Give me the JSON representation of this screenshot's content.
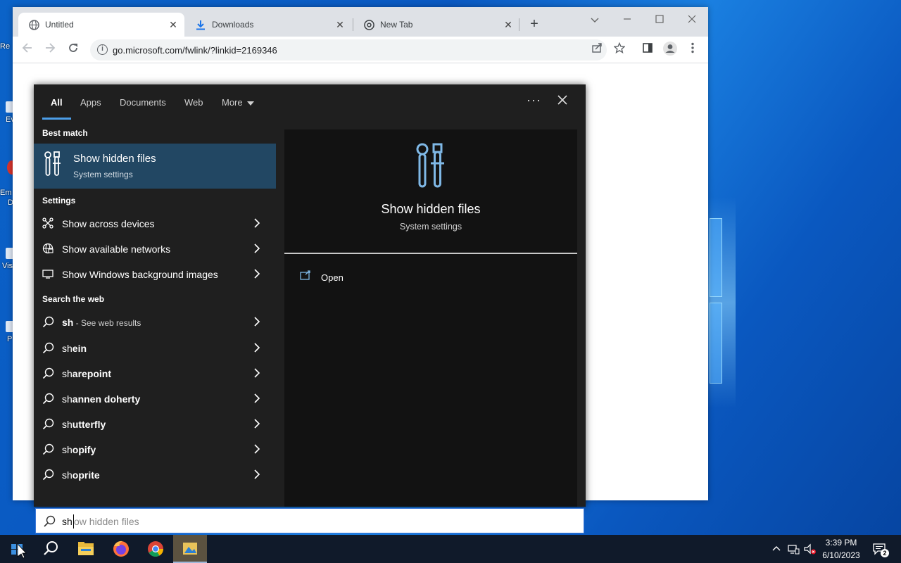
{
  "desktop": {
    "icon_labels": [
      "Re",
      "Ev",
      "Em",
      "D",
      "Vis",
      "P"
    ]
  },
  "browser": {
    "tabs": [
      {
        "title": "Untitled",
        "icon": "globe-icon",
        "active": true
      },
      {
        "title": "Downloads",
        "icon": "download-icon",
        "active": false
      },
      {
        "title": "New Tab",
        "icon": "chrome-icon",
        "active": false
      }
    ],
    "newtab_label": "+",
    "url": "go.microsoft.com/fwlink/?linkid=2169346"
  },
  "search": {
    "tabs": [
      {
        "label": "All",
        "active": true
      },
      {
        "label": "Apps"
      },
      {
        "label": "Documents"
      },
      {
        "label": "Web"
      },
      {
        "label": "More"
      }
    ],
    "dots_label": "···",
    "best_match_heading": "Best match",
    "best_match": {
      "title": "Show hidden files",
      "subtitle": "System settings"
    },
    "settings_heading": "Settings",
    "settings": [
      {
        "label": "Show across devices",
        "icon": "share-devices-icon"
      },
      {
        "label": "Show available networks",
        "icon": "globe-network-icon"
      },
      {
        "label": "Show Windows background images",
        "icon": "monitor-icon"
      }
    ],
    "web_heading": "Search the web",
    "web_results": [
      {
        "bold": "sh",
        "rest": "",
        "hint": " - See web results"
      },
      {
        "bold": "sh",
        "rest": "ein",
        "hint": ""
      },
      {
        "bold": "sh",
        "rest": "arepoint",
        "hint": ""
      },
      {
        "bold": "sh",
        "rest": "annen doherty",
        "hint": ""
      },
      {
        "bold": "sh",
        "rest": "utterfly",
        "hint": ""
      },
      {
        "bold": "sh",
        "rest": "opify",
        "hint": ""
      },
      {
        "bold": "sh",
        "rest": "oprite",
        "hint": ""
      }
    ],
    "preview": {
      "title": "Show hidden files",
      "subtitle": "System settings",
      "open_label": "Open"
    },
    "query_typed": "sh",
    "query_suggest": "ow hidden files"
  },
  "taskbar": {
    "apps": [
      "start-icon",
      "search-icon",
      "file-explorer-icon",
      "firefox-icon",
      "chrome-icon",
      "active-app-icon"
    ],
    "time": "3:39 PM",
    "date": "6/10/2023",
    "notification_count": "2"
  },
  "colors": {
    "accent": "#4c9ee8",
    "best_match_bg": "#224763",
    "panel_bg": "#1f1f1f",
    "preview_bg": "#121212"
  }
}
